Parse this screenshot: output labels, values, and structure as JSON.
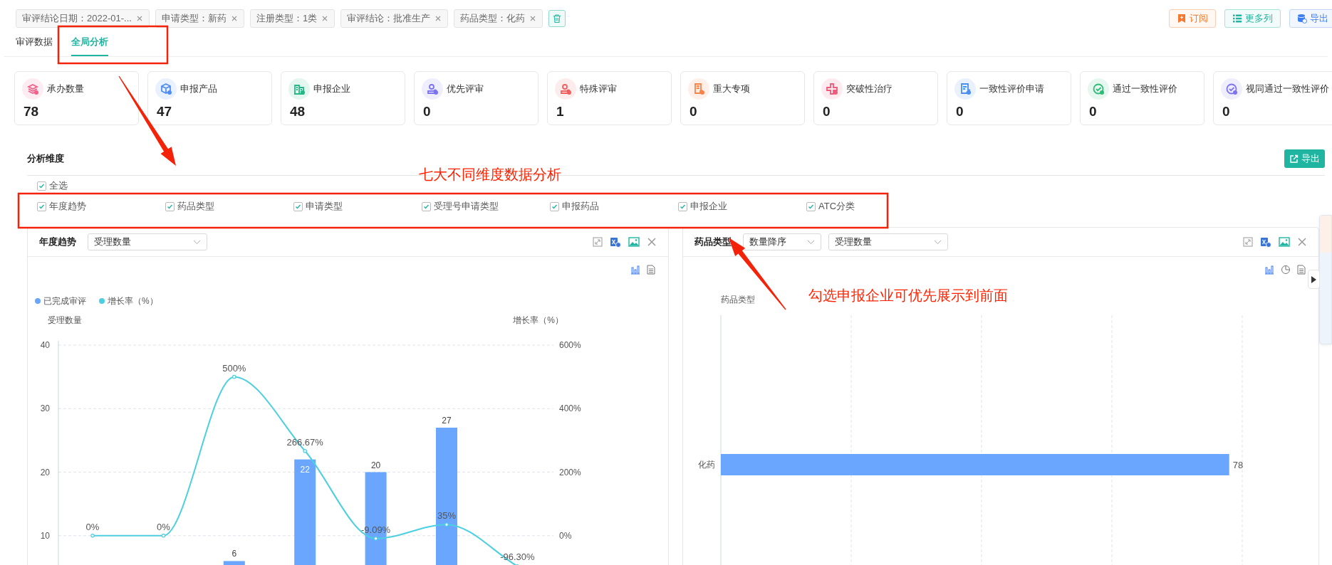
{
  "filters": {
    "tags": [
      "审评结论日期：2022-01-...",
      "申请类型：新药",
      "注册类型：1类",
      "审评结论：批准生产",
      "药品类型：化药"
    ],
    "actions": [
      {
        "label": "订阅",
        "kind": "subscribe"
      },
      {
        "label": "更多列",
        "kind": "columns"
      },
      {
        "label": "导出",
        "kind": "export"
      }
    ]
  },
  "tabs": [
    {
      "label": "审评数据",
      "selected": false
    },
    {
      "label": "全局分析",
      "selected": true
    }
  ],
  "stats": [
    {
      "label": "承办数量",
      "value": "78",
      "color": "#f2608a"
    },
    {
      "label": "申报产品",
      "value": "47",
      "color": "#4f8df5"
    },
    {
      "label": "申报企业",
      "value": "48",
      "color": "#22b985"
    },
    {
      "label": "优先评审",
      "value": "0",
      "color": "#7b73f0"
    },
    {
      "label": "特殊评审",
      "value": "1",
      "color": "#ef5f5f"
    },
    {
      "label": "重大专项",
      "value": "0",
      "color": "#f5834a"
    },
    {
      "label": "突破性治疗",
      "value": "0",
      "color": "#ef5a7a"
    },
    {
      "label": "一致性评价申请",
      "value": "0",
      "color": "#4a8ef0"
    },
    {
      "label": "通过一致性评价",
      "value": "0",
      "color": "#2fbb78"
    },
    {
      "label": "视同通过一致性评价",
      "value": "0",
      "color": "#7d72f2"
    }
  ],
  "dimensions": {
    "title": "分析维度",
    "export": "导出",
    "select_all": {
      "label": "全选",
      "checked": true
    },
    "items": [
      {
        "label": "年度趋势",
        "checked": true
      },
      {
        "label": "药品类型",
        "checked": true
      },
      {
        "label": "申请类型",
        "checked": true
      },
      {
        "label": "受理号申请类型",
        "checked": true
      },
      {
        "label": "申报药品",
        "checked": true
      },
      {
        "label": "申报企业",
        "checked": true
      },
      {
        "label": "ATC分类",
        "checked": true
      }
    ]
  },
  "charts": [
    {
      "title": "年度趋势",
      "selects": [
        "受理数量"
      ],
      "chart_data": {
        "type": "bar",
        "ylabel": "受理数量",
        "y2label": "增长率（%）",
        "ylim": [
          0,
          40
        ],
        "yticks": [
          10,
          20,
          30,
          40
        ],
        "y2lim": [
          -200,
          600
        ],
        "grid": true,
        "legend": true,
        "y2ticks": [
          {
            "value": 0,
            "label": "0%"
          },
          {
            "value": 200,
            "label": "200%"
          },
          {
            "value": 400,
            "label": "400%"
          },
          {
            "value": 600,
            "label": "600%"
          }
        ],
        "data_labels": true,
        "series": [
          {
            "name": "已完成审评",
            "type": "bar",
            "color": "#6aa5fe",
            "values": [
              null,
              null,
              6,
              22,
              20,
              27,
              null
            ]
          },
          {
            "name": "增长率（%）",
            "type": "line",
            "axis": "y2",
            "color": "#4ccfe0",
            "marker": "circle",
            "values": [
              0,
              0,
              500,
              266.67,
              -9.09,
              35,
              -96.3
            ],
            "value_labels": [
              "0%",
              "0%",
              "500%",
              "266.67%",
              "-9.09%",
              "35%",
              "-96.30%"
            ]
          }
        ]
      }
    },
    {
      "title": "药品类型",
      "selects": [
        "数量降序",
        "受理数量"
      ],
      "axis_title": "药品类型",
      "chart_data": {
        "type": "bar",
        "orientation": "horizontal",
        "categories": [
          "化药"
        ],
        "data_labels": true,
        "series": [
          {
            "color": "#6aa5fe",
            "values": [
              78
            ]
          }
        ]
      }
    }
  ],
  "annotations": [
    {
      "text": "七大不同维度数据分析"
    },
    {
      "text": "勾选申报企业可优先展示到前面"
    }
  ]
}
